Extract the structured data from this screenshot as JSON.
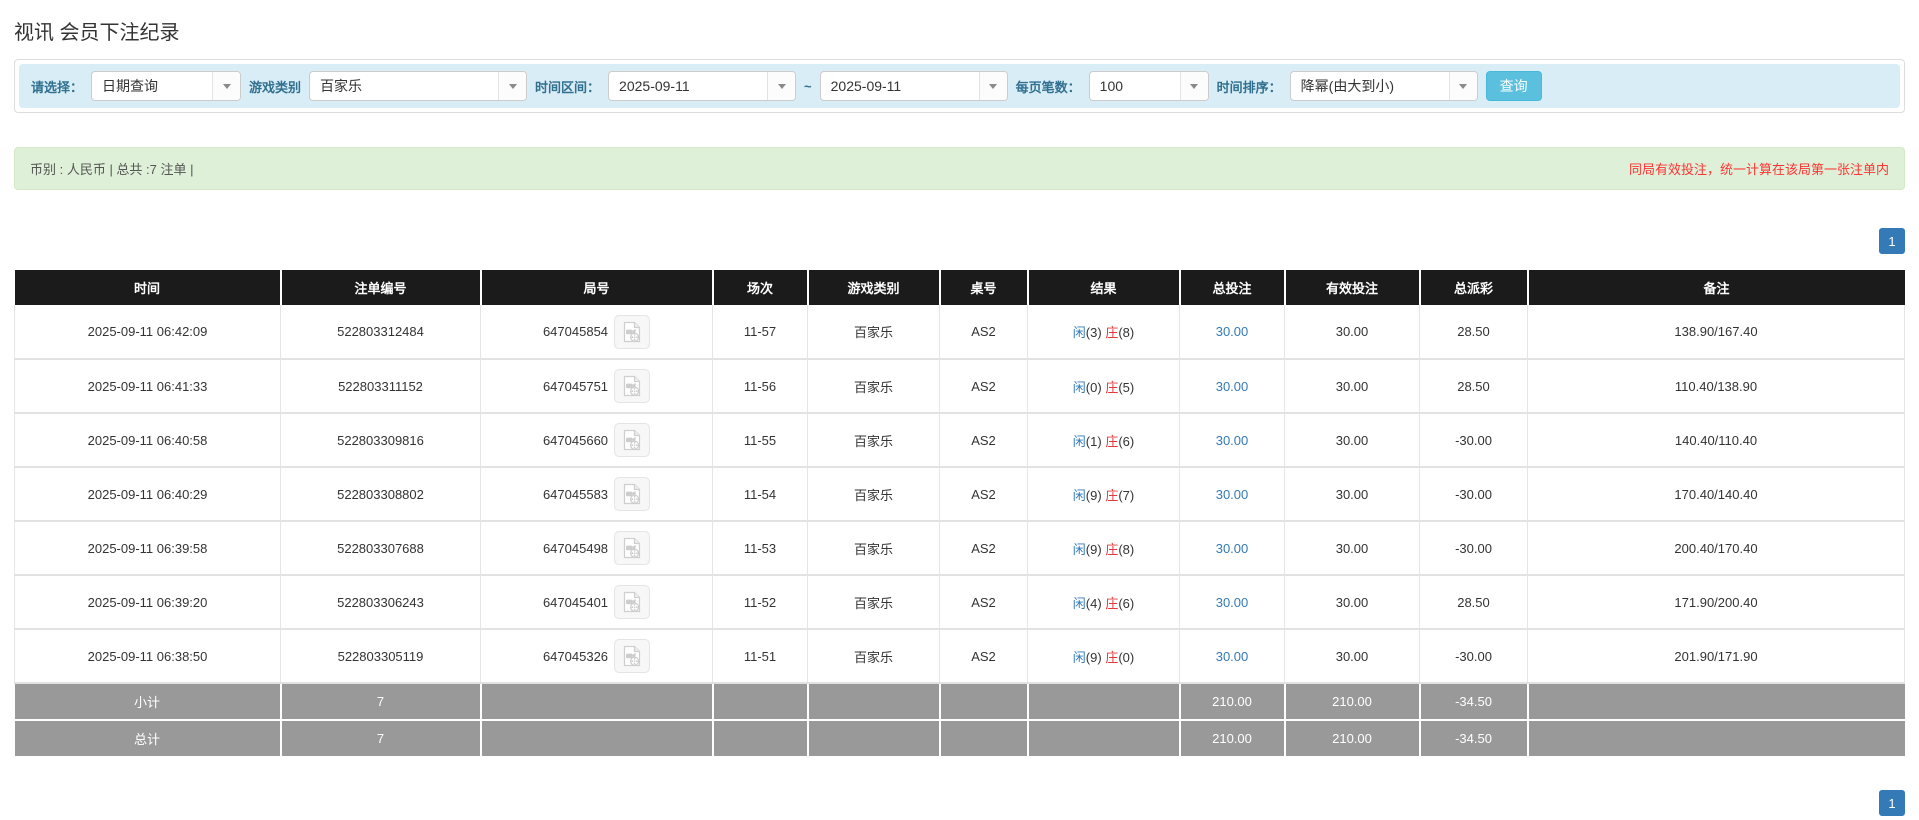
{
  "page": {
    "title": "视讯 会员下注纪录"
  },
  "colors": {
    "accent_blue": "#337ab7",
    "info_button": "#5bc0de",
    "banker_red": "#e4393c",
    "negative_red": "#ff0000",
    "header_black": "#1b1b1b",
    "footer_gray": "#999999",
    "alert_green_bg": "#dff0d8",
    "filter_blue_bg": "#d9edf7"
  },
  "filters": {
    "select_label": "请选择：",
    "select_value": "日期查询",
    "game_label": "游戏类别",
    "game_value": "百家乐",
    "range_label": "时间区间：",
    "date_from": "2025-09-11",
    "tilde": "~",
    "date_to": "2025-09-11",
    "page_size_label": "每页笔数：",
    "page_size_value": "100",
    "sort_label": "时间排序：",
    "sort_value": "降幂(由大到小)",
    "search_button": "查询"
  },
  "summary": {
    "left": "币别 : 人民币 | 总共 :7 注单 |",
    "right": "同局有效投注，统一计算在该局第一张注单内"
  },
  "pagination": {
    "page": "1"
  },
  "table": {
    "headers": [
      "时间",
      "注单编号",
      "局号",
      "场次",
      "游戏类别",
      "桌号",
      "结果",
      "总投注",
      "有效投注",
      "总派彩",
      "备注"
    ],
    "rows": [
      {
        "time": "2025-09-11 06:42:09",
        "bet_id": "522803312484",
        "round": "647045854",
        "session": "11-57",
        "game": "百家乐",
        "table_no": "AS2",
        "player": "闲",
        "player_n": "(3)",
        "banker": "庄",
        "banker_n": "(8)",
        "total_bet": "30.00",
        "valid_bet": "30.00",
        "payout": "28.50",
        "remark": "138.90/167.40"
      },
      {
        "time": "2025-09-11 06:41:33",
        "bet_id": "522803311152",
        "round": "647045751",
        "session": "11-56",
        "game": "百家乐",
        "table_no": "AS2",
        "player": "闲",
        "player_n": "(0)",
        "banker": "庄",
        "banker_n": "(5)",
        "total_bet": "30.00",
        "valid_bet": "30.00",
        "payout": "28.50",
        "remark": "110.40/138.90"
      },
      {
        "time": "2025-09-11 06:40:58",
        "bet_id": "522803309816",
        "round": "647045660",
        "session": "11-55",
        "game": "百家乐",
        "table_no": "AS2",
        "player": "闲",
        "player_n": "(1)",
        "banker": "庄",
        "banker_n": "(6)",
        "total_bet": "30.00",
        "valid_bet": "30.00",
        "payout": "-30.00",
        "remark": "140.40/110.40"
      },
      {
        "time": "2025-09-11 06:40:29",
        "bet_id": "522803308802",
        "round": "647045583",
        "session": "11-54",
        "game": "百家乐",
        "table_no": "AS2",
        "player": "闲",
        "player_n": "(9)",
        "banker": "庄",
        "banker_n": "(7)",
        "total_bet": "30.00",
        "valid_bet": "30.00",
        "payout": "-30.00",
        "remark": "170.40/140.40"
      },
      {
        "time": "2025-09-11 06:39:58",
        "bet_id": "522803307688",
        "round": "647045498",
        "session": "11-53",
        "game": "百家乐",
        "table_no": "AS2",
        "player": "闲",
        "player_n": "(9)",
        "banker": "庄",
        "banker_n": "(8)",
        "total_bet": "30.00",
        "valid_bet": "30.00",
        "payout": "-30.00",
        "remark": "200.40/170.40"
      },
      {
        "time": "2025-09-11 06:39:20",
        "bet_id": "522803306243",
        "round": "647045401",
        "session": "11-52",
        "game": "百家乐",
        "table_no": "AS2",
        "player": "闲",
        "player_n": "(4)",
        "banker": "庄",
        "banker_n": "(6)",
        "total_bet": "30.00",
        "valid_bet": "30.00",
        "payout": "28.50",
        "remark": "171.90/200.40"
      },
      {
        "time": "2025-09-11 06:38:50",
        "bet_id": "522803305119",
        "round": "647045326",
        "session": "11-51",
        "game": "百家乐",
        "table_no": "AS2",
        "player": "闲",
        "player_n": "(9)",
        "banker": "庄",
        "banker_n": "(0)",
        "total_bet": "30.00",
        "valid_bet": "30.00",
        "payout": "-30.00",
        "remark": "201.90/171.90"
      }
    ],
    "subtotal": {
      "label": "小计",
      "count": "7",
      "total_bet": "210.00",
      "valid_bet": "210.00",
      "payout": "-34.50"
    },
    "total": {
      "label": "总计",
      "count": "7",
      "total_bet": "210.00",
      "valid_bet": "210.00",
      "payout": "-34.50"
    }
  }
}
